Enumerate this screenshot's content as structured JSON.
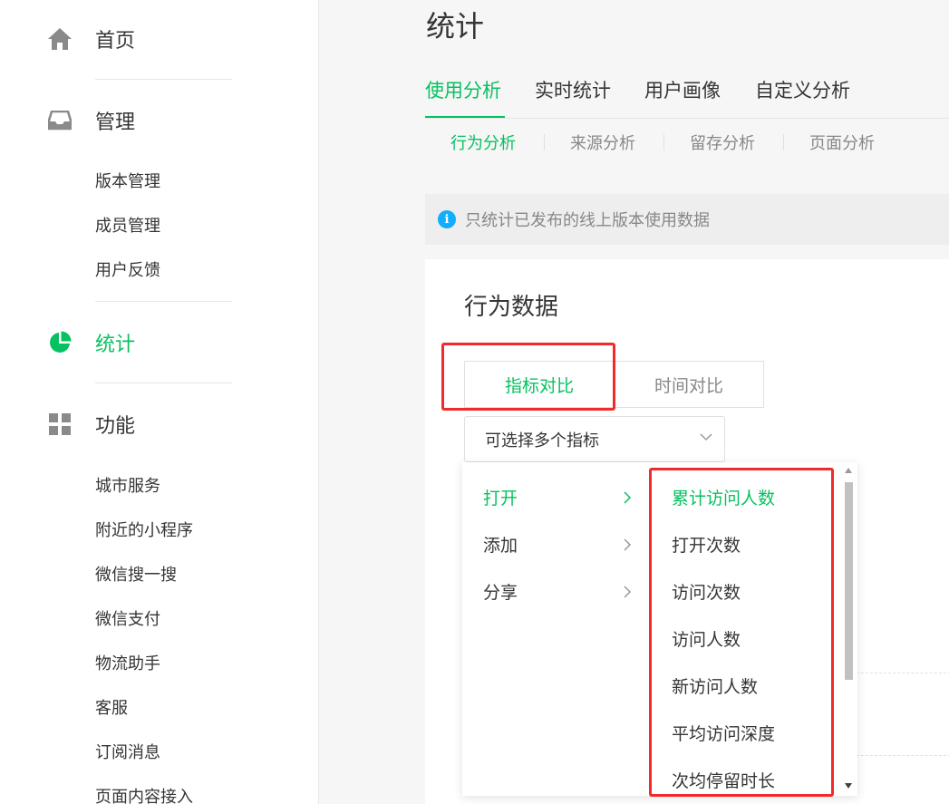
{
  "sidebar": {
    "home": {
      "label": "首页",
      "icon": "home-icon"
    },
    "manage": {
      "label": "管理",
      "icon": "inbox-icon",
      "items": [
        "版本管理",
        "成员管理",
        "用户反馈"
      ]
    },
    "stats": {
      "label": "统计",
      "icon": "pie-chart-icon"
    },
    "features": {
      "label": "功能",
      "icon": "grid-icon",
      "items": [
        "城市服务",
        "附近的小程序",
        "微信搜一搜",
        "微信支付",
        "物流助手",
        "客服",
        "订阅消息",
        "页面内容接入"
      ]
    }
  },
  "main": {
    "title": "统计",
    "tabs": [
      "使用分析",
      "实时统计",
      "用户画像",
      "自定义分析"
    ],
    "subtabs": [
      "行为分析",
      "来源分析",
      "留存分析",
      "页面分析"
    ],
    "notice": "只统计已发布的线上版本使用数据",
    "card": {
      "title": "行为数据",
      "segments": [
        "指标对比",
        "时间对比"
      ],
      "select_placeholder": "可选择多个指标"
    }
  },
  "dropdown": {
    "categories": [
      "打开",
      "添加",
      "分享"
    ],
    "options": [
      "累计访问人数",
      "打开次数",
      "访问次数",
      "访问人数",
      "新访问人数",
      "平均访问深度",
      "次均停留时长"
    ]
  },
  "colors": {
    "accent": "#07c160",
    "highlight": "#f12b2b",
    "info": "#10aeff"
  }
}
